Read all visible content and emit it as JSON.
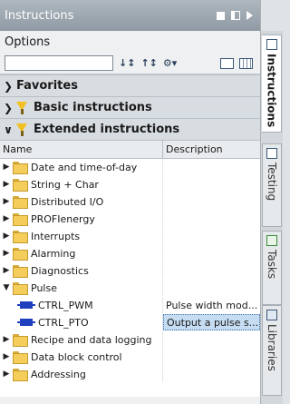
{
  "window": {
    "title": "Instructions"
  },
  "options": {
    "label": "Options",
    "search_value": ""
  },
  "sections": {
    "favorites": "Favorites",
    "basic": "Basic instructions",
    "extended": "Extended instructions"
  },
  "columns": {
    "name": "Name",
    "description": "Description"
  },
  "tree": [
    {
      "label": "Date and time-of-day",
      "desc": ""
    },
    {
      "label": "String + Char",
      "desc": ""
    },
    {
      "label": "Distributed I/O",
      "desc": ""
    },
    {
      "label": "PROFIenergy",
      "desc": ""
    },
    {
      "label": "Interrupts",
      "desc": ""
    },
    {
      "label": "Alarming",
      "desc": ""
    },
    {
      "label": "Diagnostics",
      "desc": ""
    },
    {
      "label": "Pulse",
      "desc": ""
    },
    {
      "label": "CTRL_PWM",
      "desc": "Pulse width mod..."
    },
    {
      "label": "CTRL_PTO",
      "desc": "Output a pulse s..."
    },
    {
      "label": "Recipe and data logging",
      "desc": ""
    },
    {
      "label": "Data block control",
      "desc": ""
    },
    {
      "label": "Addressing",
      "desc": ""
    }
  ],
  "side_tabs": {
    "instructions": "Instructions",
    "testing": "Testing",
    "tasks": "Tasks",
    "libraries": "Libraries"
  }
}
